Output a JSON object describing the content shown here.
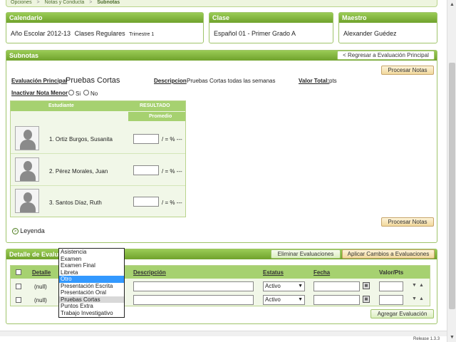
{
  "breadcrumb": [
    "Opciones",
    "Notas y Conducta",
    "Subnotas"
  ],
  "calendario": {
    "title": "Calendario",
    "year": "Año Escolar 2012-13",
    "type": "Clases Regulares",
    "term": "Trimestre 1"
  },
  "clase": {
    "title": "Clase",
    "value": "Español 01 -  Primer Grado  A"
  },
  "maestro": {
    "title": "Maestro",
    "value": "Alexander Guédez"
  },
  "subnotas": {
    "title": "Subnotas",
    "back_button": "< Regresar a Evaluación Principal",
    "process_button": "Procesar Notas",
    "eval_label": "Evaluación Principal",
    "eval_value": "Pruebas Cortas",
    "desc_label": "Descripcion",
    "desc_value": "Pruebas Cortas todas las semanas",
    "valor_label": "Valor Total:",
    "valor_value": "pts",
    "inactivar_label": "Inactivar Nota Menor",
    "radio_si": "Si",
    "radio_no": "No",
    "col_student": "Estudiante",
    "col_result": "RESULTADO",
    "col_promedio": "Promedio",
    "students": [
      {
        "name": "1. Ortiz Burgos, Susanita",
        "suffix": "/ = % ---"
      },
      {
        "name": "2. Pérez Morales, Juan",
        "suffix": "/ = % ---"
      },
      {
        "name": "3. Santos Díaz, Ruth",
        "suffix": "/ = % ---"
      }
    ],
    "legend": "Leyenda"
  },
  "detalle": {
    "title": "Detalle de Evalua",
    "delete_button": "Eliminar Evaluaciones",
    "apply_button": "Aplicar Cambios a Evaluaciones",
    "headers": {
      "detalle": "Detalle",
      "descripcion": "Descripción",
      "estatus": "Estatus",
      "fecha": "Fecha",
      "valor": "Valor/Pts"
    },
    "rows": [
      {
        "detalle": "(null)",
        "estatus": "Activo"
      },
      {
        "detalle": "(null)",
        "estatus": "Activo"
      }
    ],
    "add_button": "Agregar Evaluación",
    "dropdown_options": [
      "Asistencia",
      "Examen",
      "Examen Final",
      "Libreta",
      "Otro",
      "Presentación Escrita",
      "Presentación Oral",
      "Pruebas Cortas",
      "Puntos Extra",
      "Trabajo Investigativo"
    ],
    "dropdown_selected": "Otro",
    "dropdown_hovered": "Pruebas Cortas"
  },
  "footer": {
    "release": "Release 1.3.3"
  },
  "colors": {
    "accent": "#7fb23a",
    "button": "#f1d89c",
    "highlight": "#3399ff"
  }
}
